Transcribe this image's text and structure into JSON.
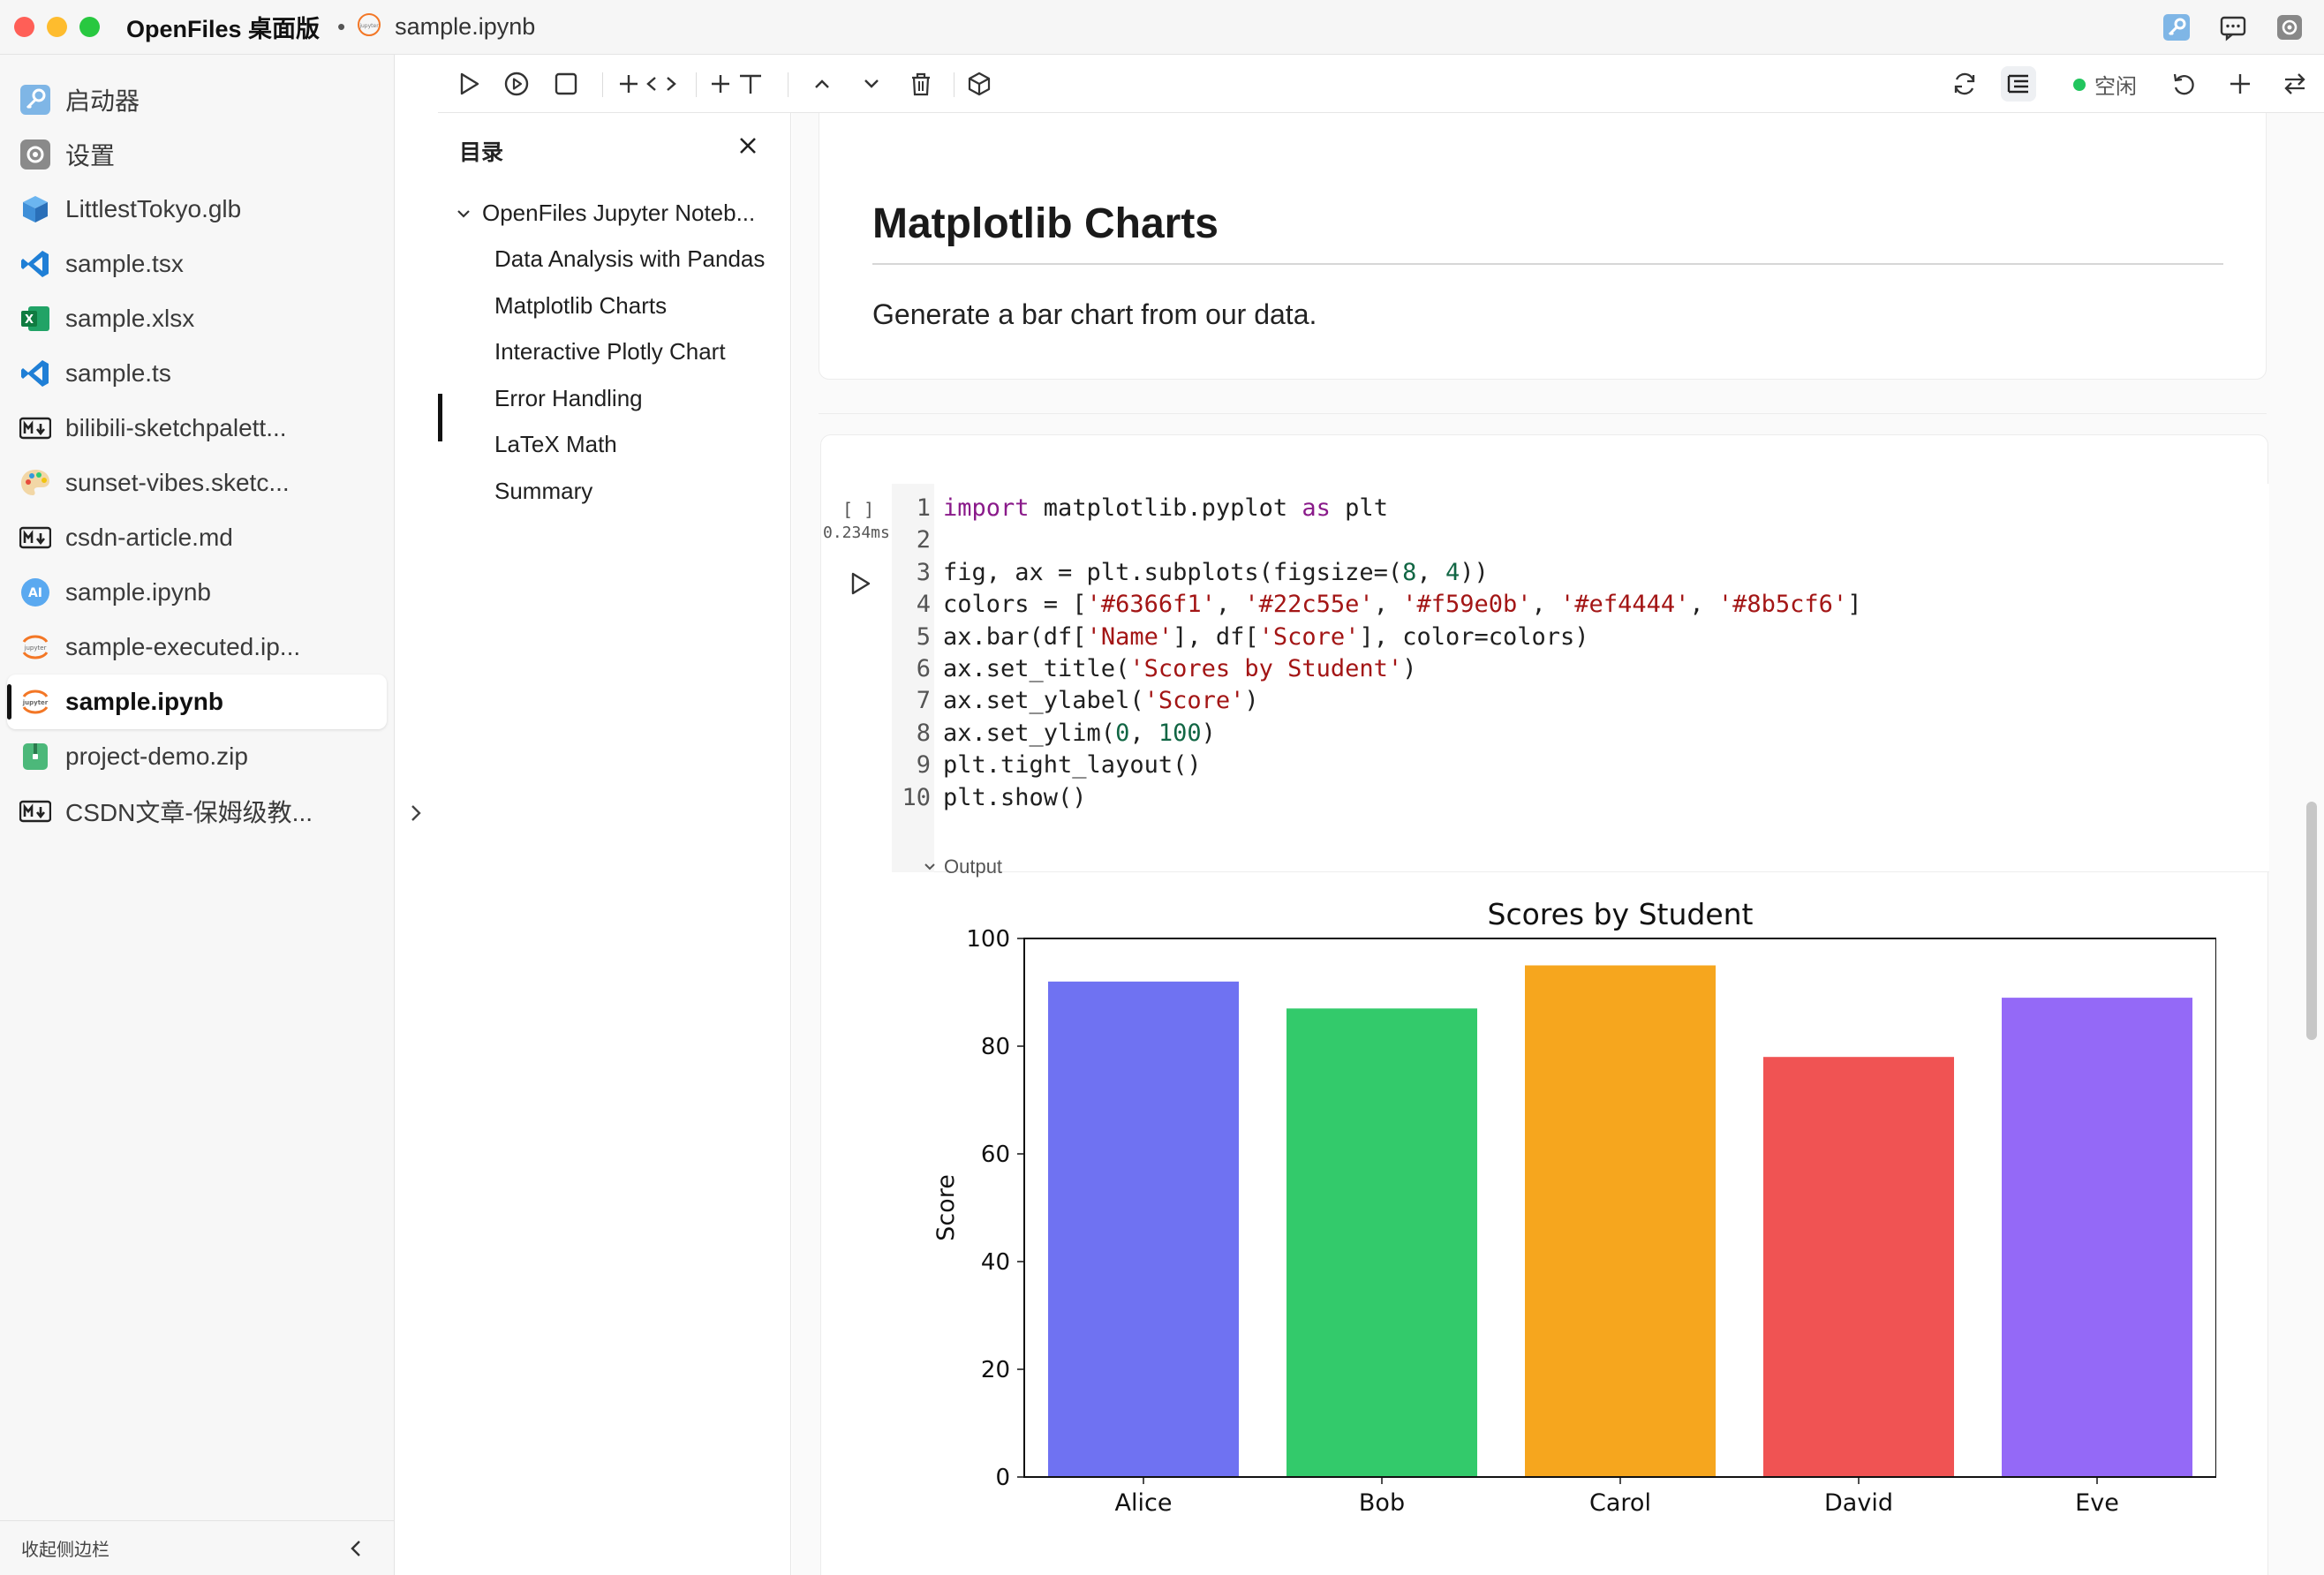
{
  "window": {
    "app_title": "OpenFiles 桌面版",
    "separator": "•",
    "file_title": "sample.ipynb",
    "icons": [
      "key-icon",
      "chat-icon",
      "settings-icon"
    ]
  },
  "sidebar": {
    "items": [
      {
        "label": "启动器",
        "icon": "launcher-icon"
      },
      {
        "label": "设置",
        "icon": "gear-icon"
      },
      {
        "label": "LittlestTokyo.glb",
        "icon": "cube-icon"
      },
      {
        "label": "sample.tsx",
        "icon": "vscode-icon"
      },
      {
        "label": "sample.xlsx",
        "icon": "excel-icon"
      },
      {
        "label": "sample.ts",
        "icon": "vscode-icon"
      },
      {
        "label": "bilibili-sketchpalett...",
        "icon": "markdown-icon"
      },
      {
        "label": "sunset-vibes.sketc...",
        "icon": "palette-icon"
      },
      {
        "label": "csdn-article.md",
        "icon": "markdown-icon"
      },
      {
        "label": "sample.ipynb",
        "icon": "ai-icon"
      },
      {
        "label": "sample-executed.ip...",
        "icon": "jupyter-icon"
      },
      {
        "label": "sample.ipynb",
        "icon": "jupyter-icon",
        "active": true
      },
      {
        "label": "project-demo.zip",
        "icon": "archive-icon"
      },
      {
        "label": "CSDN文章-保姆级教...",
        "icon": "markdown-icon"
      }
    ],
    "footer_label": "收起侧边栏"
  },
  "toolbar": {
    "kernel_status": "空闲",
    "kernel_color": "#22c55e"
  },
  "toc": {
    "title": "目录",
    "root": "OpenFiles Jupyter Noteb...",
    "items": [
      "Data Analysis with Pandas",
      "Matplotlib Charts",
      "Interactive Plotly Chart",
      "Error Handling",
      "LaTeX Math",
      "Summary"
    ],
    "active_item": "Matplotlib Charts"
  },
  "notebook": {
    "markdown": {
      "heading": "Matplotlib Charts",
      "paragraph": "Generate a bar chart from our data."
    },
    "code_cell": {
      "exec_count": "[ ]",
      "exec_time": "0.234ms",
      "lines": [
        "import matplotlib.pyplot as plt",
        "",
        "fig, ax = plt.subplots(figsize=(8, 4))",
        "colors = ['#6366f1', '#22c55e', '#f59e0b', '#ef4444', '#8b5cf6']",
        "ax.bar(df['Name'], df['Score'], color=colors)",
        "ax.set_title('Scores by Student')",
        "ax.set_ylabel('Score')",
        "ax.set_ylim(0, 100)",
        "plt.tight_layout()",
        "plt.show()"
      ],
      "output_label": "Output"
    }
  },
  "chart_data": {
    "type": "bar",
    "title": "Scores by Student",
    "xlabel": "",
    "ylabel": "Score",
    "categories": [
      "Alice",
      "Bob",
      "Carol",
      "David",
      "Eve"
    ],
    "values": [
      92,
      87,
      95,
      78,
      89
    ],
    "colors": [
      "#6366f1",
      "#22c55e",
      "#f59e0b",
      "#ef4444",
      "#8b5cf6"
    ],
    "ylim": [
      0,
      100
    ],
    "yticks": [
      0,
      20,
      40,
      60,
      80,
      100
    ],
    "grid": false
  }
}
